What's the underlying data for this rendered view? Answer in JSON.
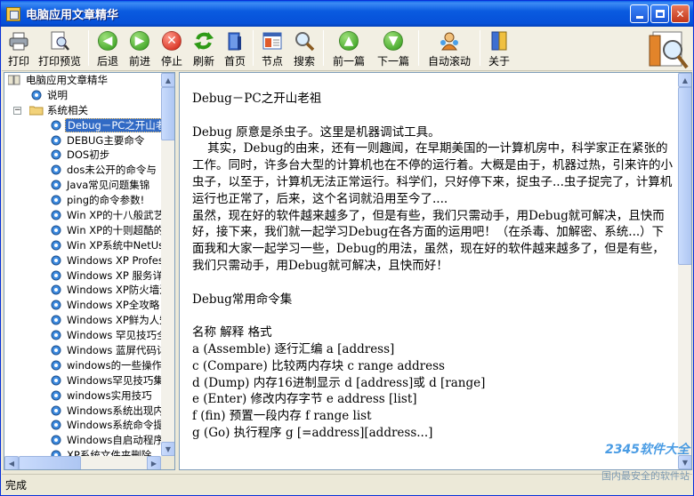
{
  "window": {
    "title": "电脑应用文章精华"
  },
  "toolbar": {
    "buttons": [
      {
        "label": "打印"
      },
      {
        "label": "打印预览"
      },
      {
        "label": "后退"
      },
      {
        "label": "前进"
      },
      {
        "label": "停止"
      },
      {
        "label": "刷新"
      },
      {
        "label": "首页"
      },
      {
        "label": "节点"
      },
      {
        "label": "搜索"
      },
      {
        "label": "前一篇"
      },
      {
        "label": "下一篇"
      },
      {
        "label": "自动滚动"
      },
      {
        "label": "关于"
      }
    ]
  },
  "tree": {
    "root": "电脑应用文章精华",
    "readme": "说明",
    "folder": "系统相关",
    "items": [
      "Debug－PC之开山老",
      "DEBUG主要命令",
      "DOS初步",
      "dos未公开的命令与",
      "Java常见问题集锦",
      "ping的命令参数!",
      "Win XP的十八般武艺",
      "Win XP的十则超酷的",
      "Win XP系统中NetUse",
      "Windows XP Professi",
      "Windows XP 服务详解",
      "Windows XP防火墙浅",
      "Windows XP全攻略",
      "Windows XP鲜为人知",
      "Windows 罕见技巧全",
      "Windows 蓝屏代码详",
      "windows的一些操作",
      "Windows罕见技巧集",
      "windows实用技巧",
      "Windows系统出现内",
      "Windows系统命令提",
      "Windows自启动程序",
      "XP系统文件夹删除"
    ]
  },
  "document": {
    "title": "Debug－PC之开山老祖",
    "paragraphs": [
      "Debug 原意是杀虫子。这里是机器调试工具。",
      "    其实，Debug的由来，还有一则趣闻，在早期美国的一计算机房中，科学家正在紧张的工作。同时，许多台大型的计算机也在不停的运行着。大概是由于，机器过热，引来许的小虫子，以至于，计算机无法正常运行。科学们，只好停下来，捉虫子...虫子捉完了，计算机运行也正常了，后来，这个名词就沿用至今了....",
      "虽然，现在好的软件越来越多了，但是有些，我们只需动手，用Debug就可解决，且快而好，接下来，我们就一起学习Debug在各方面的运用吧！（在杀毒、加解密、系统...）下面我和大家一起学习一些，Debug的用法，虽然，现在好的软件越来越多了，但是有些，我们只需动手，用Debug就可解决，且快而好！"
    ],
    "section_title": "Debug常用命令集",
    "table_header": "名称 解释 格式",
    "commands": [
      "a (Assemble) 逐行汇编 a [address]",
      "c (Compare) 比较两内存块 c range address",
      "d (Dump) 内存16进制显示 d [address]或 d [range]",
      "e (Enter) 修改内存字节 e address [list]",
      "f (fin) 预置一段内存 f range list",
      "g (Go) 执行程序 g [=address][address...]"
    ]
  },
  "status": {
    "text": "完成"
  },
  "watermark": {
    "line1": "2345软件大全",
    "line2": "国内最安全的软件站"
  }
}
